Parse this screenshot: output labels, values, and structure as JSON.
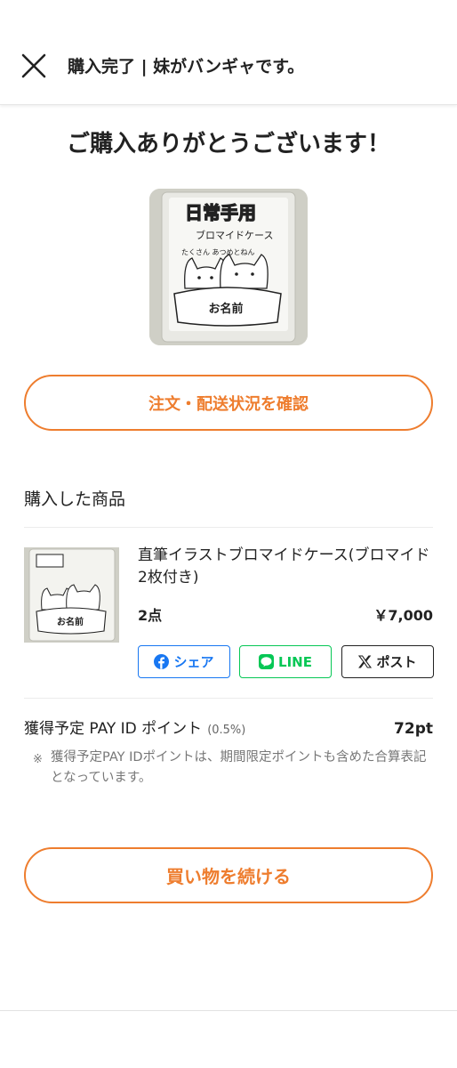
{
  "header": {
    "title": "購入完了 | 妹がバンギャです。",
    "close_icon": "close-icon"
  },
  "thanks_message": "ご購入ありがとうございます！",
  "hero_image": {
    "caption_top": "日常手用",
    "caption_line2": "ブロマイドケース",
    "caption_line3": "たくさん あつめとねん",
    "name_tag": "お名前"
  },
  "order_status_button": "注文・配送状況を確認",
  "purchased_section": {
    "title": "購入した商品",
    "product": {
      "name": "直筆イラストブロマイドケース(ブロマイド2枚付き)",
      "quantity": "2点",
      "price": "￥7,000",
      "thumb_name_tag": "お名前"
    },
    "share": {
      "facebook": "シェア",
      "line": "LINE",
      "x": "ポスト"
    }
  },
  "points": {
    "label": "獲得予定 PAY ID ポイント",
    "rate": "(0.5%)",
    "value": "72pt",
    "note_mark": "※",
    "note": "獲得予定PAY IDポイントは、期間限定ポイントも含めた合算表記となっています。"
  },
  "continue_button": "買い物を続ける",
  "colors": {
    "accent": "#ee7d2e",
    "facebook": "#1877f2",
    "line": "#06c755",
    "x": "#222222"
  }
}
